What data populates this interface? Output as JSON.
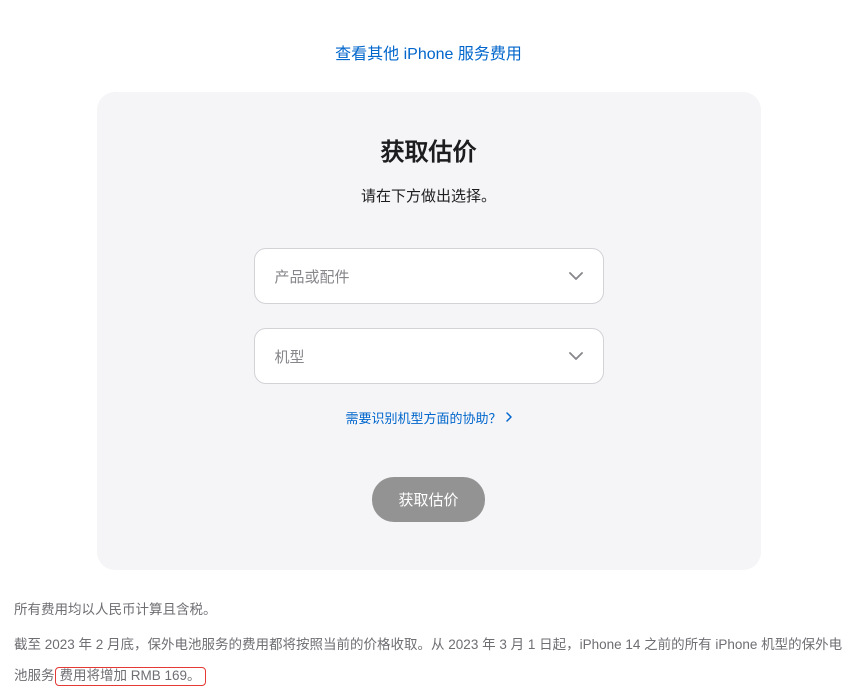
{
  "topLink": {
    "text": "查看其他 iPhone 服务费用"
  },
  "card": {
    "title": "获取估价",
    "subtitle": "请在下方做出选择。",
    "select1": {
      "placeholder": "产品或配件"
    },
    "select2": {
      "placeholder": "机型"
    },
    "helpLink": {
      "text": "需要识别机型方面的协助？"
    },
    "button": {
      "label": "获取估价"
    }
  },
  "footer": {
    "line1": "所有费用均以人民币计算且含税。",
    "line2a": "截至 2023 年 2 月底，保外电池服务的费用都将按照当前的价格收取。从 2023 年 3 月 1 日起，iPhone 14 之前的所有 iPhone 机型的保外电池服务",
    "line2b": "费用将增加 RMB 169。"
  }
}
